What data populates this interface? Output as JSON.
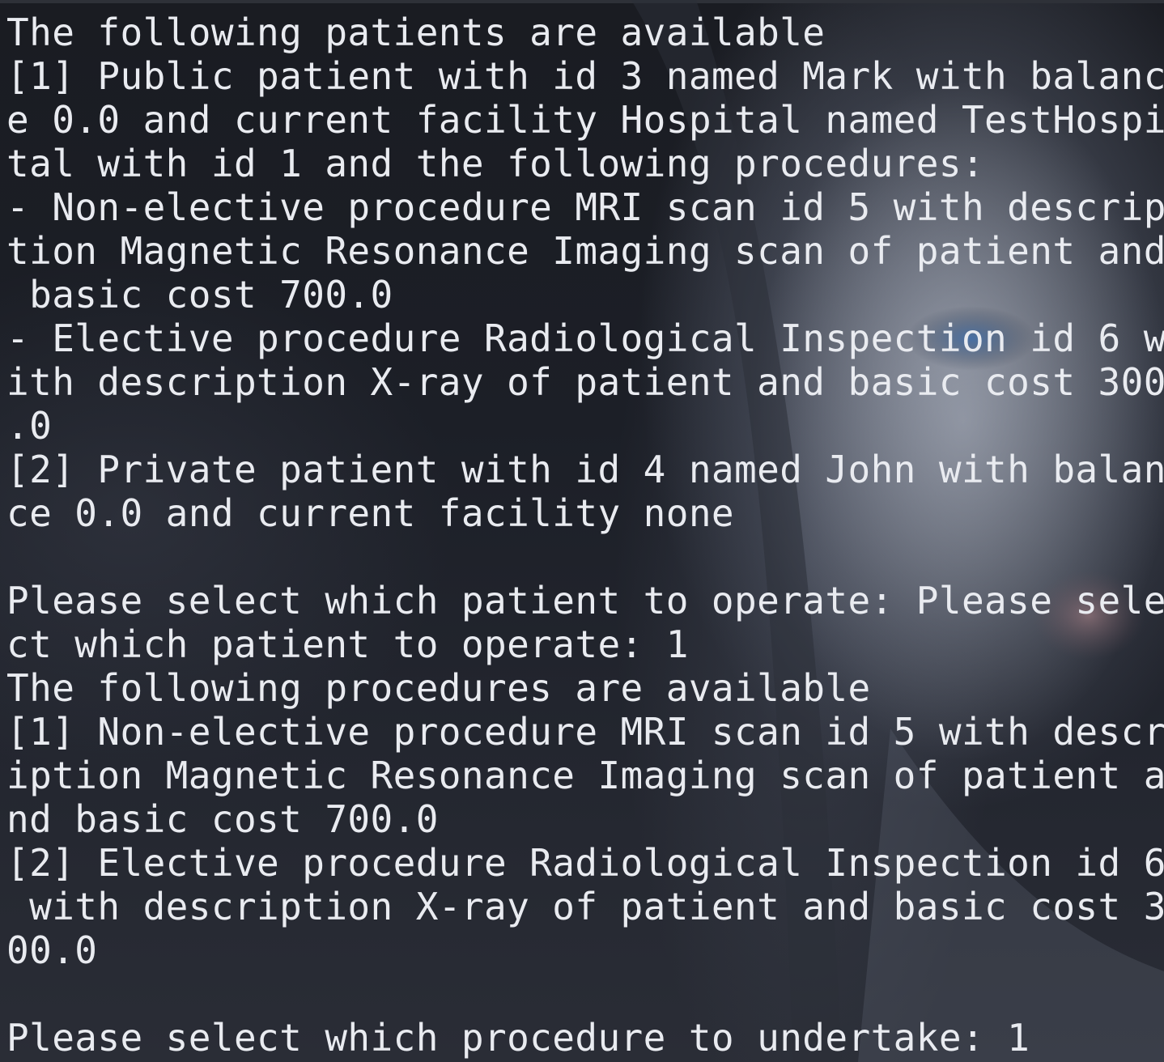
{
  "terminal": {
    "lines": [
      "The following patients are available",
      "[1] Public patient with id 3 named Mark with balanc",
      "e 0.0 and current facility Hospital named TestHospi",
      "tal with id 1 and the following procedures:",
      "- Non-elective procedure MRI scan id 5 with descrip",
      "tion Magnetic Resonance Imaging scan of patient and",
      " basic cost 700.0",
      "- Elective procedure Radiological Inspection id 6 w",
      "ith description X-ray of patient and basic cost 300",
      ".0",
      "[2] Private patient with id 4 named John with balan",
      "ce 0.0 and current facility none",
      "",
      "Please select which patient to operate: Please sele",
      "ct which patient to operate: 1",
      "The following procedures are available",
      "[1] Non-elective procedure MRI scan id 5 with descr",
      "iption Magnetic Resonance Imaging scan of patient a",
      "nd basic cost 700.0",
      "[2] Elective procedure Radiological Inspection id 6",
      " with description X-ray of patient and basic cost 3",
      "00.0",
      "",
      "Please select which procedure to undertake: 1"
    ]
  },
  "colors": {
    "text": "#e9ebf0",
    "background": "#1c1f27"
  }
}
